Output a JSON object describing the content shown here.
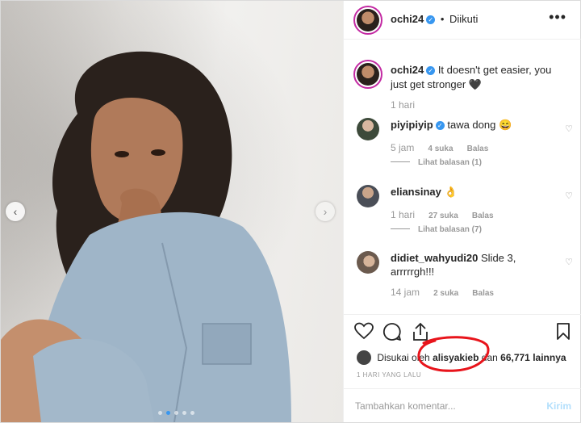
{
  "header": {
    "username": "ochi24",
    "dot": "•",
    "follow_status": "Diikuti",
    "more_icon": "more-options-icon"
  },
  "caption": {
    "username": "ochi24",
    "text": "It doesn't get easier, you just get stronger 🖤",
    "time": "1 hari"
  },
  "comments": [
    {
      "username": "piyipiyip",
      "verified": true,
      "text": "tawa dong 😄",
      "time": "5 jam",
      "likes": "4 suka",
      "reply": "Balas",
      "view_replies": "Lihat balasan (1)"
    },
    {
      "username": "eliansinay",
      "verified": false,
      "text": "👌",
      "time": "1 hari",
      "likes": "27 suka",
      "reply": "Balas",
      "view_replies": "Lihat balasan (7)"
    },
    {
      "username": "didiet_wahyudi20",
      "verified": false,
      "text": "Slide 3, arrrrrgh!!!",
      "time": "14 jam",
      "likes": "2 suka",
      "reply": "Balas",
      "view_replies": ""
    }
  ],
  "likes": {
    "prefix": "Disukai oleh",
    "user": "alisyakieb",
    "joiner": "dan",
    "count": "66,771 lainnya"
  },
  "post_date": "1 HARI YANG LALU",
  "add_comment": {
    "placeholder": "Tambahkan komentar...",
    "send": "Kirim"
  },
  "colors": {
    "accent": "#3897f0",
    "annotation": "#e8141b",
    "story_ring": "#c32aa3"
  }
}
